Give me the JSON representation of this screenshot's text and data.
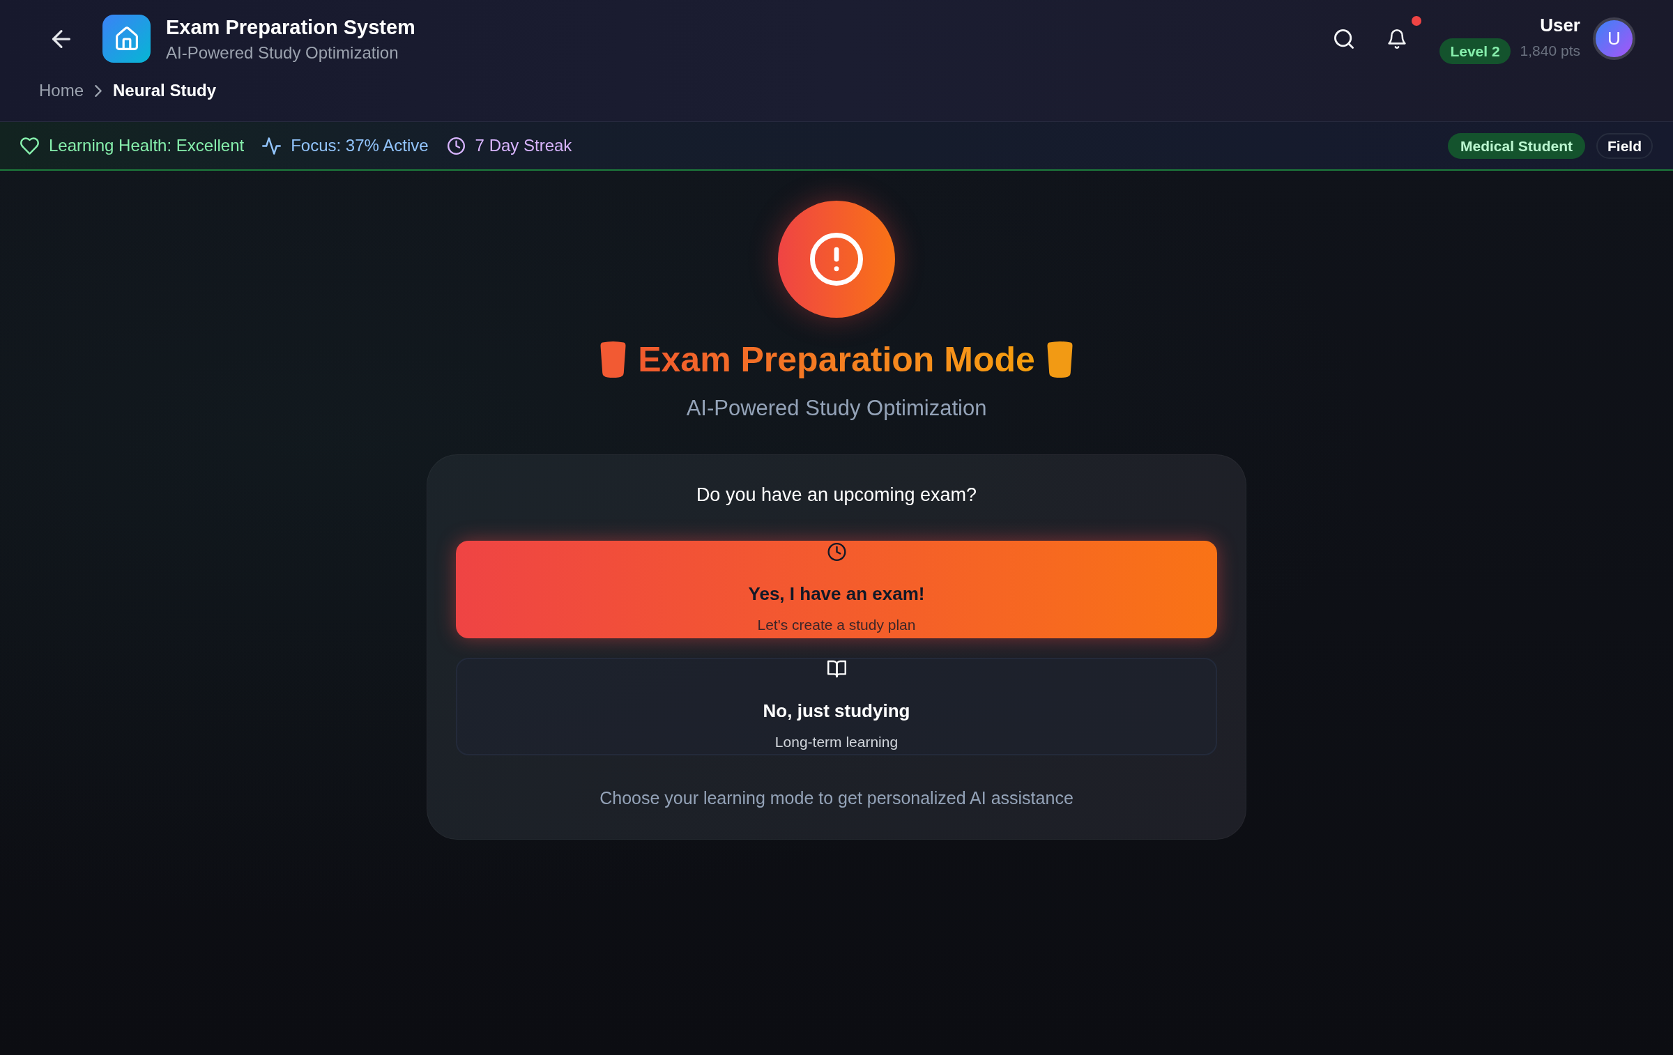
{
  "header": {
    "title": "Exam Preparation System",
    "subtitle": "AI-Powered Study Optimization",
    "breadcrumb": [
      {
        "label": "Home",
        "current": false
      },
      {
        "label": "Neural Study",
        "current": true
      }
    ],
    "notifications": {
      "unread": true
    },
    "user": {
      "name": "User",
      "level": "Level 2",
      "points": "1,840 pts",
      "initial": "U"
    }
  },
  "status_bar": {
    "items": [
      {
        "kind": "health",
        "label": "Learning Health: Excellent",
        "color": "#86efac"
      },
      {
        "kind": "focus",
        "label": "Focus: 37% Active",
        "color": "#93c5fd"
      },
      {
        "kind": "streak",
        "label": "7 Day Streak",
        "color": "#d8b4fe"
      }
    ],
    "tags": [
      {
        "kind": "filled",
        "label": "Medical Student"
      },
      {
        "kind": "outline",
        "label": "Field"
      }
    ]
  },
  "hero": {
    "title": "Exam Preparation Mode",
    "subtitle": "AI-Powered Study Optimization"
  },
  "card": {
    "question": "Do you have an upcoming exam?",
    "options": [
      {
        "kind": "exam",
        "title": "Yes, I have an exam!",
        "subtitle": "Let's create a study plan",
        "selected": true
      },
      {
        "kind": "study",
        "title": "No, just studying",
        "subtitle": "Long-term learning",
        "selected": false
      }
    ],
    "hint": "Choose your learning mode to get personalized AI assistance"
  }
}
